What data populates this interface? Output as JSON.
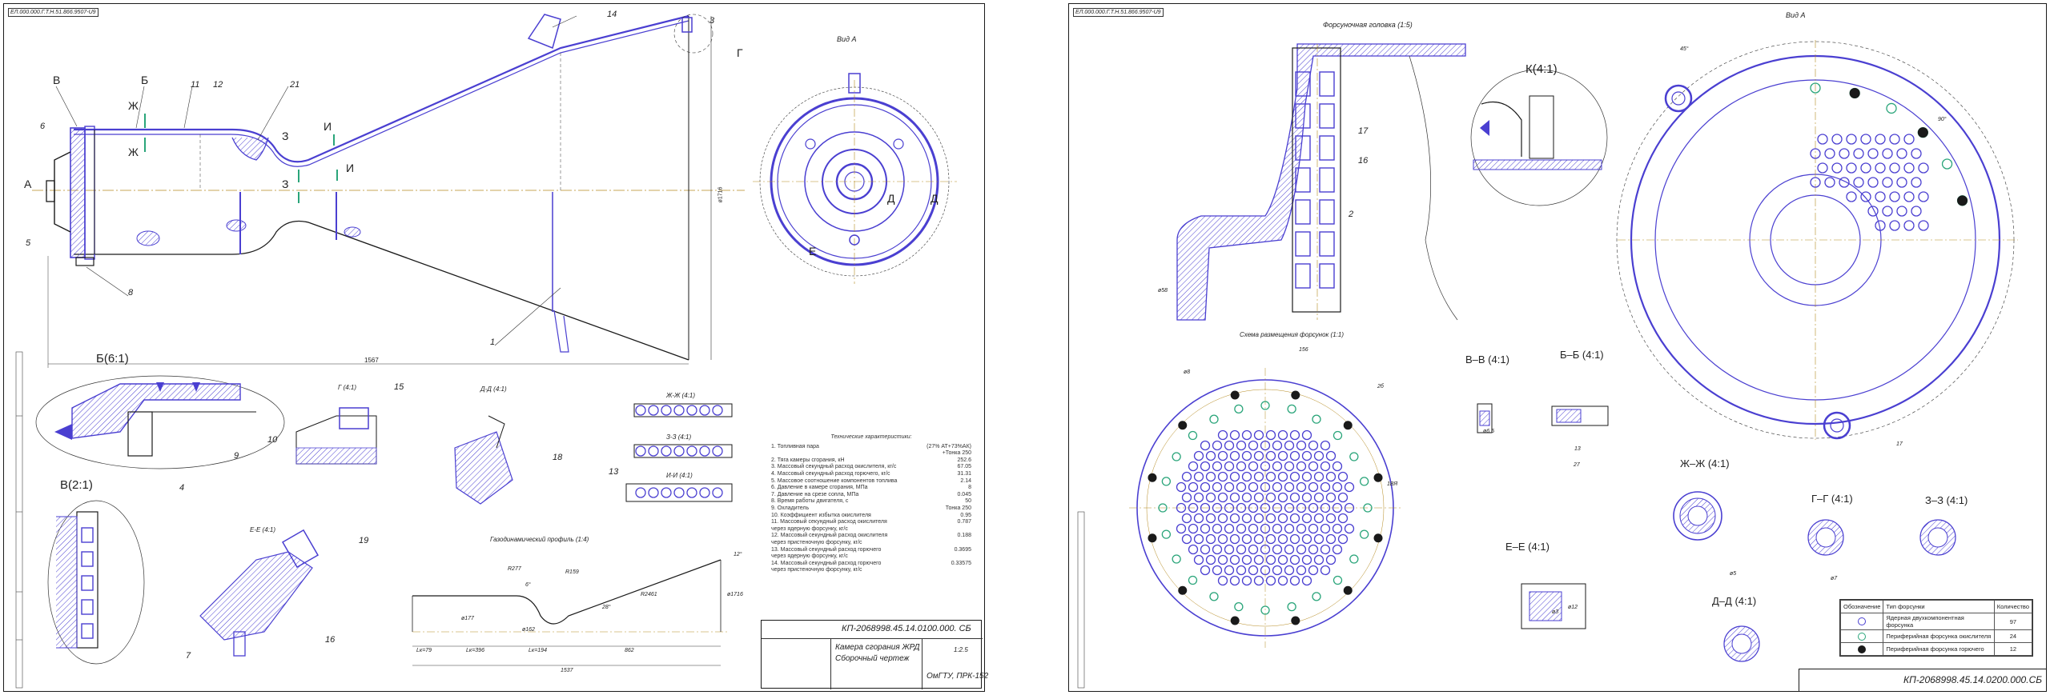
{
  "sheet1": {
    "corner_code": "ЕЛ.000.000.Г.Т.Н.51.866.9507-U9",
    "view_a_title": "Вид А",
    "section_b_title": "Б(6:1)",
    "section_v_title": "В(2:1)",
    "section_g_title": "Г (4:1)",
    "section_d_title": "Д-Д (4:1)",
    "section_e_title": "Е-Е (4:1)",
    "section_zh_title": "Ж-Ж (4:1)",
    "section_z_title": "З-З (4:1)",
    "section_i_title": "И-И (4:1)",
    "profile_title": "Газодинамический профиль (1:4)",
    "overall_dim": "1567",
    "diameter_dim": "ø1716",
    "letters": [
      "В",
      "Б",
      "Ж",
      "Ж",
      "З",
      "З",
      "И",
      "И",
      "А",
      "Д",
      "Д",
      "Е",
      "Г"
    ],
    "callouts": [
      "1",
      "3",
      "4",
      "5",
      "6",
      "7",
      "8",
      "9",
      "10",
      "11",
      "12",
      "13",
      "14",
      "15",
      "16",
      "18",
      "19",
      "21"
    ],
    "profile_dims": [
      "R277",
      "R159",
      "R2461",
      "28°",
      "6°",
      "ø177",
      "ø162",
      "ø1716",
      "Lк=79",
      "Lк=396",
      "Lк=194",
      "862",
      "1537",
      "12°"
    ],
    "spec_title": "Технические характеристики:",
    "spec_rows": [
      [
        "1. Топливная пара",
        "(27% АТ+73%АК)"
      ],
      [
        "",
        "+Тонка 250"
      ],
      [
        "2. Тяга камеры сгорания, кН",
        "252.6"
      ],
      [
        "3. Массовый секундный расход окислителя, кг/с",
        "67.05"
      ],
      [
        "4. Массовый секундный расход горючего, кг/с",
        "31.31"
      ],
      [
        "5. Массовое соотношение компонентов топлива",
        "2.14"
      ],
      [
        "6. Давление в камере сгорания, МПа",
        "8"
      ],
      [
        "7. Давление на срезе сопла, МПа",
        "0.045"
      ],
      [
        "8. Время работы двигателя, с",
        "50"
      ],
      [
        "9. Охладитель",
        "Тонка 250"
      ],
      [
        "10. Коэффициент избытка окислителя",
        "0.95"
      ],
      [
        "11. Массовый секундный расход окислителя",
        "0.787"
      ],
      [
        "через ядерную форсунку, кг/с",
        ""
      ],
      [
        "12. Массовый секундный расход окислителя",
        "0.188"
      ],
      [
        "через пристеночную форсунку, кг/с",
        ""
      ],
      [
        "13. Массовый секундный расход горючего",
        "0.3695"
      ],
      [
        "через ядерную форсунку, кг/с",
        ""
      ],
      [
        "14. Массовый секундный расход горючего",
        "0.33575"
      ],
      [
        "через пристеночную форсунку, кг/с",
        ""
      ]
    ],
    "stamp_code": "КП-2068998.45.14.0100.000. СБ",
    "stamp_name": "Камера сгорания ЖРД",
    "stamp_subname": "Сборочный чертеж",
    "stamp_org": "ОмГТУ, ПРК-152",
    "stamp_scale": "1:2.5"
  },
  "sheet2": {
    "corner_code": "ЕЛ.000.000.Г.Т.Н.51.866.9507-U9",
    "head_title": "Форсуночная головка (1:5)",
    "view_k_title": "К(4:1)",
    "view_a_title": "Вид А",
    "layout_title": "Схема размещения форсунок (1:1)",
    "section_vv": "В–В (4:1)",
    "section_bb": "Б–Б (4:1)",
    "section_ee": "Е–Е (4:1)",
    "section_zhzh": "Ж–Ж (4:1)",
    "section_gg": "Г–Г (4:1)",
    "section_zz": "З–З (4:1)",
    "section_dd": "Д–Д (4:1)",
    "callouts": [
      "2",
      "16",
      "17"
    ],
    "dims": [
      "ø58",
      "ø8",
      "156",
      "2б",
      "1ВЯ",
      "ø3",
      "ø12",
      "ø6.5",
      "27",
      "13",
      "ø5",
      "ø7",
      "17",
      "45°",
      "90°"
    ],
    "stamp_code": "КП-2068998.45.14.0200.000.СБ",
    "legend": {
      "headers": [
        "Обозначение",
        "Тип форсунки",
        "Количество"
      ],
      "rows": [
        {
          "type": "Ядерная двухкомпонентная форсунка",
          "count": "97",
          "color": "#4a3fd1",
          "fill": "none"
        },
        {
          "type": "Периферийная форсунка окислителя",
          "count": "24",
          "color": "#2aa57a",
          "fill": "none"
        },
        {
          "type": "Периферийная форсунка горючего",
          "count": "12",
          "color": "#1a1a1a",
          "fill": "#1a1a1a"
        }
      ]
    }
  }
}
